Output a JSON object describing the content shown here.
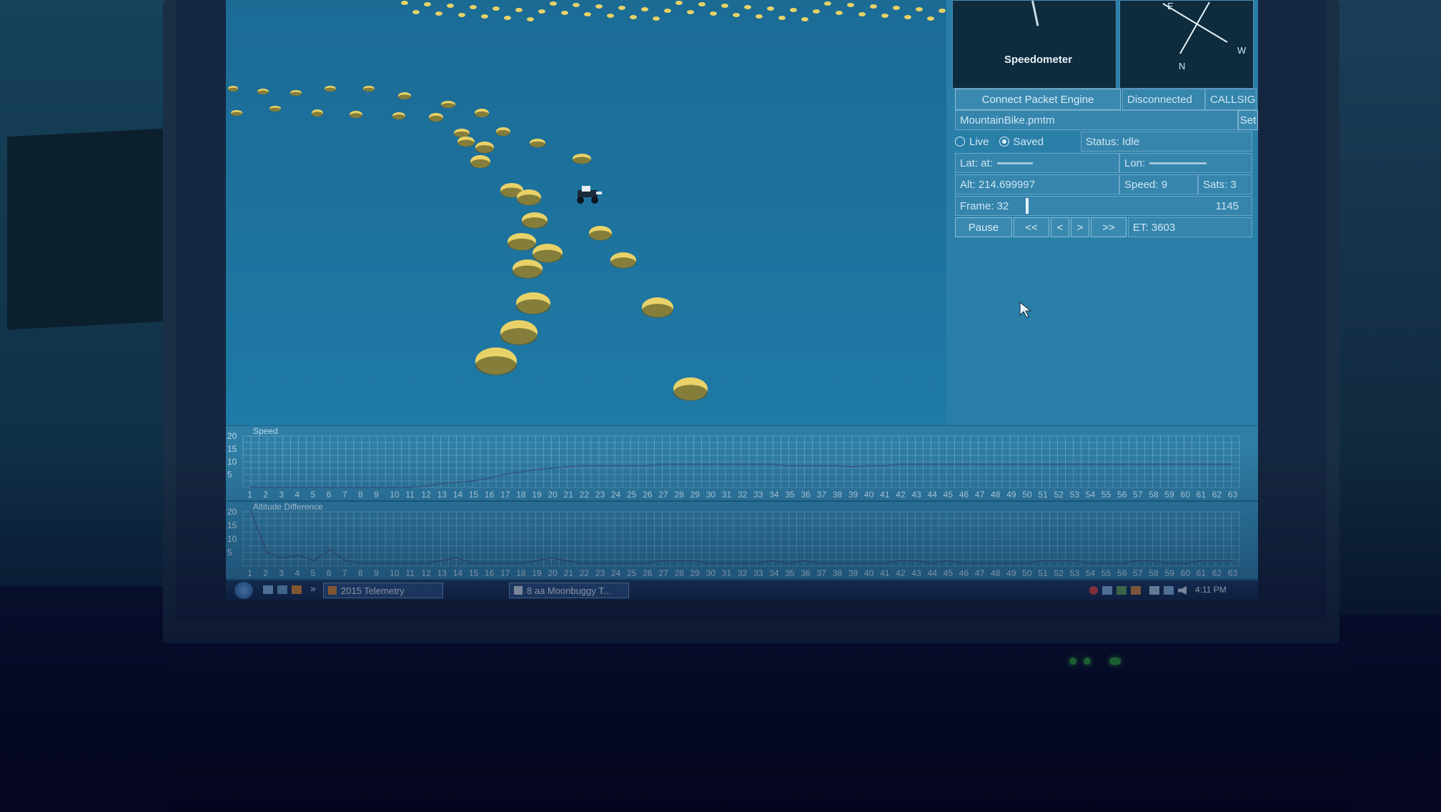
{
  "gauges": {
    "speedometer_label": "Speedometer",
    "compass": {
      "e": "E",
      "w": "W",
      "n": "N"
    }
  },
  "controls": {
    "connect_button": "Connect Packet Engine",
    "connection_status": "Disconnected",
    "callsign": "CALLSIGN",
    "file_name": "MountainBike.pmtm",
    "set_button": "Set",
    "mode_live": "Live",
    "mode_saved": "Saved",
    "selected_mode": "Saved",
    "status": "Status: Idle"
  },
  "telemetry": {
    "lat_label": "Lat: at:",
    "lon_label": "Lon:",
    "alt": "Alt: 214.699997",
    "speed": "Speed: 9",
    "sats": "Sats: 3",
    "frame": "Frame: 32",
    "frame_total": "1145",
    "frame_progress": 0.028,
    "et": "ET: 3603"
  },
  "playback": {
    "pause": "Pause",
    "rewind": "<<",
    "step_back": "<",
    "step_forward": ">",
    "fast_forward": ">>"
  },
  "charts": [
    {
      "title": "Speed",
      "y_ticks": [
        "20",
        "15",
        "10",
        "5"
      ],
      "x_ticks": [
        "1",
        "2",
        "3",
        "4",
        "5",
        "6",
        "7",
        "8",
        "9",
        "10",
        "11",
        "12",
        "13",
        "14",
        "15",
        "16",
        "17",
        "18",
        "19",
        "20",
        "21",
        "22",
        "23",
        "24",
        "25",
        "26",
        "27",
        "28",
        "29",
        "30",
        "31",
        "32",
        "33",
        "34",
        "35",
        "36",
        "37",
        "38",
        "39",
        "40",
        "41",
        "42",
        "43",
        "44",
        "45",
        "46",
        "47",
        "48",
        "49",
        "50",
        "51",
        "52",
        "53",
        "54",
        "55",
        "56",
        "57",
        "58",
        "59",
        "60",
        "61",
        "62",
        "63"
      ]
    },
    {
      "title": "Altitude Difference",
      "y_ticks": [
        "20",
        "15",
        "10",
        "5"
      ],
      "x_ticks": [
        "1",
        "2",
        "3",
        "4",
        "5",
        "6",
        "7",
        "8",
        "9",
        "10",
        "11",
        "12",
        "13",
        "14",
        "15",
        "16",
        "17",
        "18",
        "19",
        "20",
        "21",
        "22",
        "23",
        "24",
        "25",
        "26",
        "27",
        "28",
        "29",
        "30",
        "31",
        "32",
        "33",
        "34",
        "35",
        "36",
        "37",
        "38",
        "39",
        "40",
        "41",
        "42",
        "43",
        "44",
        "45",
        "46",
        "47",
        "48",
        "49",
        "50",
        "51",
        "52",
        "53",
        "54",
        "55",
        "56",
        "57",
        "58",
        "59",
        "60",
        "61",
        "62",
        "63"
      ]
    }
  ],
  "chart_data": [
    {
      "type": "line",
      "title": "Speed",
      "x": [
        1,
        2,
        3,
        4,
        5,
        6,
        7,
        8,
        9,
        10,
        11,
        12,
        13,
        14,
        15,
        16,
        17,
        18,
        19,
        20,
        21,
        22,
        23,
        24,
        25,
        26,
        27,
        28,
        29,
        30,
        31,
        32,
        33,
        34,
        35,
        36,
        37,
        38,
        39,
        40,
        41,
        42,
        43,
        44,
        45,
        46,
        47,
        48,
        49,
        50,
        51,
        52,
        53,
        54,
        55,
        56,
        57,
        58,
        59,
        60,
        61,
        62,
        63
      ],
      "series": [
        {
          "values": [
            0,
            0,
            0,
            0,
            0,
            0,
            0,
            0,
            0,
            0,
            0,
            0.5,
            1.5,
            2,
            2.5,
            3.5,
            5,
            6,
            7,
            7.5,
            8,
            8.5,
            8.5,
            8.5,
            8.5,
            8.5,
            9,
            9,
            9,
            9,
            9,
            9,
            9,
            9,
            8.5,
            8.5,
            8.5,
            8.5,
            8,
            8.5,
            8.5,
            9,
            9,
            9,
            9,
            9,
            9,
            9,
            9,
            9,
            9,
            9,
            9,
            9,
            9,
            9,
            9,
            9,
            9,
            9,
            9,
            9,
            9
          ]
        }
      ],
      "ylim": [
        0,
        20
      ]
    },
    {
      "type": "line",
      "title": "Altitude Difference",
      "x": [
        1,
        2,
        3,
        4,
        5,
        6,
        7,
        8,
        9,
        10,
        11,
        12,
        13,
        14,
        15,
        16,
        17,
        18,
        19,
        20,
        21,
        22,
        23,
        24,
        25,
        26,
        27,
        28,
        29,
        30,
        31,
        32,
        33,
        34,
        35,
        36,
        37,
        38,
        39,
        40,
        41,
        42,
        43,
        44,
        45,
        46,
        47,
        48,
        49,
        50,
        51,
        52,
        53,
        54,
        55,
        56,
        57,
        58,
        59,
        60,
        61,
        62,
        63
      ],
      "series": [
        {
          "values": [
            20,
            5,
            3,
            4,
            2,
            6,
            2,
            1,
            1,
            1,
            1,
            1,
            2,
            3,
            1,
            1,
            1,
            1,
            2,
            3,
            2,
            1,
            1,
            1,
            1,
            1,
            2,
            2,
            2,
            1,
            1,
            1,
            1,
            2,
            1,
            2,
            1,
            1,
            1,
            1,
            1,
            2,
            2,
            1,
            2,
            1,
            1,
            1,
            1,
            1,
            2,
            2,
            2,
            1,
            1,
            1,
            2,
            2,
            1,
            1,
            2,
            2,
            2
          ]
        }
      ],
      "ylim": [
        0,
        20
      ]
    }
  ],
  "taskbar": {
    "quick_launch_more": "»",
    "tasks": [
      "2015 Telemetry",
      "8 aa Moonbuggy T..."
    ],
    "clock": "4:11 PM"
  }
}
